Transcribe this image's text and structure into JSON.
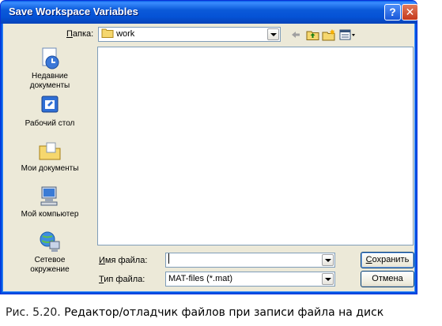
{
  "window": {
    "title": "Save Workspace Variables",
    "help_glyph": "?",
    "close_glyph": "✕"
  },
  "location": {
    "label_prefix": "",
    "label_underlined": "П",
    "label_rest": "апка:",
    "value": "work"
  },
  "toolbar": {
    "icons": [
      "back-arrow-icon",
      "up-folder-icon",
      "new-folder-icon",
      "view-menu-icon"
    ]
  },
  "places": [
    {
      "name": "recent",
      "line1": "Недавние",
      "line2": "документы",
      "icon": "recent-documents-icon"
    },
    {
      "name": "desktop",
      "line1": "Рабочий стол",
      "line2": "",
      "icon": "desktop-icon"
    },
    {
      "name": "my-documents",
      "line1": "Мои документы",
      "line2": "",
      "icon": "my-documents-icon"
    },
    {
      "name": "my-computer",
      "line1": "Мой компьютер",
      "line2": "",
      "icon": "my-computer-icon"
    },
    {
      "name": "network",
      "line1": "Сетевое",
      "line2": "окружение",
      "icon": "network-icon"
    }
  ],
  "filename": {
    "label_underlined": "И",
    "label_rest": "мя файла:",
    "value": ""
  },
  "filetype": {
    "label_underlined": "Т",
    "label_rest": "ип файла:",
    "value": "MAT-files (*.mat)"
  },
  "buttons": {
    "save_underlined": "С",
    "save_rest": "охранить",
    "cancel": "Отмена"
  },
  "caption": {
    "prefix": "Рис. 5.20.",
    "text": " Редактор/отладчик файлов при записи файла на диск"
  },
  "colors": {
    "titlebar": "#0b5ad9",
    "dialog_bg": "#ece9d8",
    "close_button": "#c4381b"
  }
}
